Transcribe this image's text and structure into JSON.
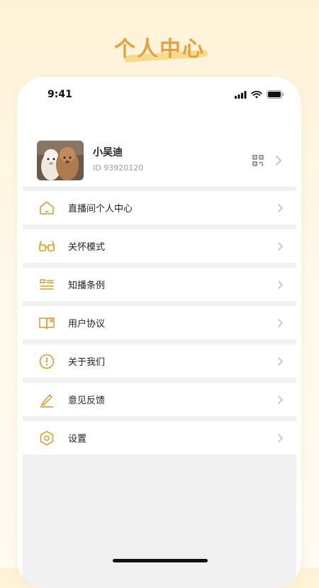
{
  "header": {
    "title": "个人中心"
  },
  "status_bar": {
    "time": "9:41"
  },
  "profile": {
    "name": "小吴迪",
    "id_text": "ID 93920120"
  },
  "menu": [
    {
      "label": "直播间个人中心",
      "icon": "home-icon"
    },
    {
      "label": "关怀模式",
      "icon": "glasses-icon"
    },
    {
      "label": "知播条例",
      "icon": "list-icon"
    },
    {
      "label": "用户协议",
      "icon": "book-icon"
    },
    {
      "label": "关于我们",
      "icon": "info-icon"
    },
    {
      "label": "意见反馈",
      "icon": "pen-icon"
    },
    {
      "label": "设置",
      "icon": "settings-icon"
    }
  ],
  "colors": {
    "accent": "#e7a13a",
    "icon": "#d99a2b",
    "chevron": "#b8b8b8"
  }
}
